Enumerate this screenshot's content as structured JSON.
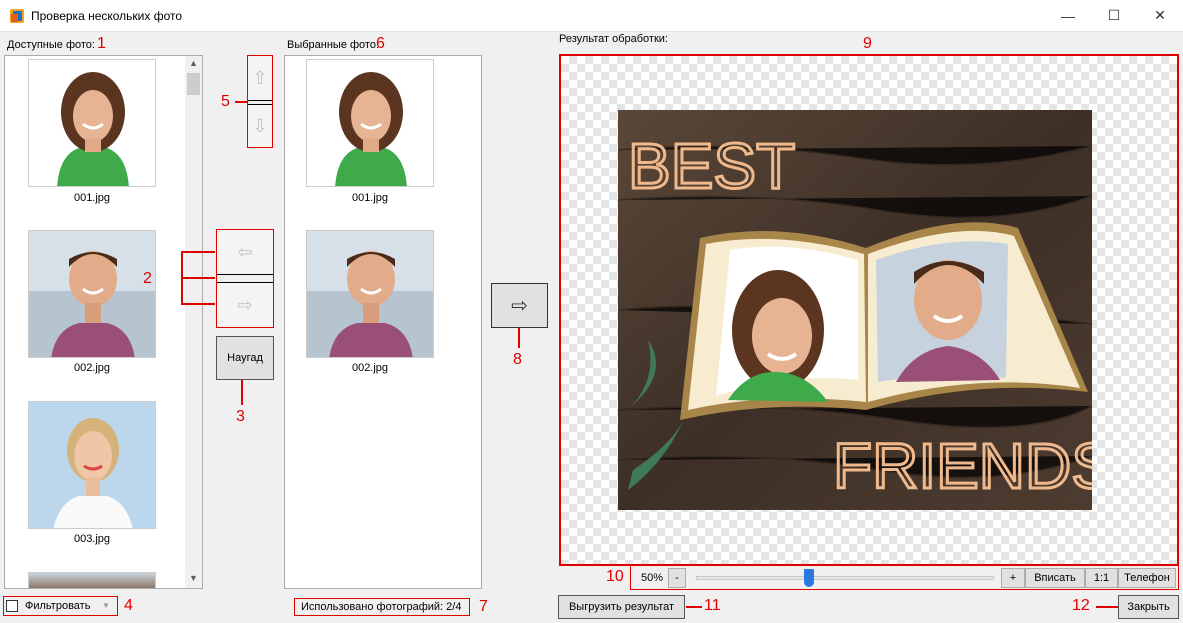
{
  "window": {
    "title": "Проверка нескольких фото",
    "minimize": "—",
    "maximize": "☐",
    "close": "✕"
  },
  "available": {
    "label": "Доступные фото:",
    "items": [
      {
        "name": "001.jpg"
      },
      {
        "name": "002.jpg"
      },
      {
        "name": "003.jpg"
      }
    ],
    "marker": "1"
  },
  "selected": {
    "label": "Выбранные фото:",
    "items": [
      {
        "name": "001.jpg"
      },
      {
        "name": "002.jpg"
      }
    ],
    "marker": "6"
  },
  "controls": {
    "up_arrow": "⇧",
    "down_arrow": "⇩",
    "left_arrow": "⇦",
    "right_arrow": "⇨",
    "random_label": "Наугад",
    "process_arrow": "⇨"
  },
  "filter": {
    "label": "Фильтровать",
    "checked": false
  },
  "usage": {
    "text": "Использовано фотографий: 2/4"
  },
  "result": {
    "label": "Результат обработки:",
    "marker": "9",
    "card_top_text": "BEST",
    "card_bottom_text": "FRIENDS"
  },
  "zoom": {
    "value": "50%",
    "minus": "-",
    "plus": "+",
    "fit": "Вписать",
    "one_to_one": "1:1",
    "phone": "Телефон",
    "slider_level": 0.38
  },
  "actions": {
    "export_label": "Выгрузить результат",
    "close_label": "Закрыть"
  },
  "markers": {
    "m2": "2",
    "m3": "3",
    "m4": "4",
    "m5": "5",
    "m7": "7",
    "m8": "8",
    "m10": "10",
    "m11": "11",
    "m12": "12"
  },
  "colors": {
    "annotation": "#e00000",
    "wood": "#4a3a30",
    "accent_blue": "#2a7ae2"
  }
}
